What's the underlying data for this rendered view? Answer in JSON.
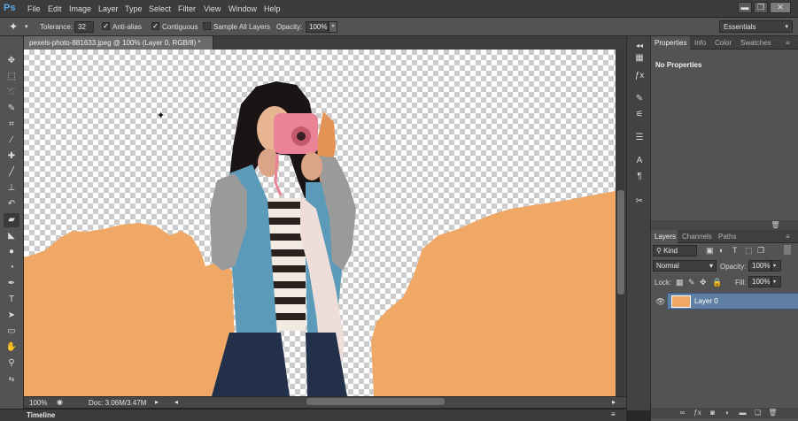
{
  "app": {
    "logo": "Ps"
  },
  "menu": [
    "File",
    "Edit",
    "Image",
    "Layer",
    "Type",
    "Select",
    "Filter",
    "View",
    "Window",
    "Help"
  ],
  "window_controls": {
    "minimize": "▬",
    "restore": "❐",
    "close": "✕"
  },
  "options": {
    "tolerance_label": "Tolerance:",
    "tolerance_value": "32",
    "anti_alias_label": "Anti-alias",
    "anti_alias_checked": true,
    "contiguous_label": "Contiguous",
    "contiguous_checked": true,
    "sample_all_label": "Sample All Layers",
    "sample_all_checked": false,
    "opacity_label": "Opacity:",
    "opacity_value": "100%",
    "workspace": "Essentials"
  },
  "document": {
    "tab_title": "pexels-photo-881633.jpeg @ 100% (Layer 0, RGB/8) *",
    "tab_close": "×",
    "colors": {
      "orange": "#f0a866",
      "orange_dark": "#e39355",
      "denim": "#5b9ab9",
      "jeans": "#22304a"
    }
  },
  "status": {
    "zoom": "100%",
    "doc_size": "Doc: 3.06M/3.47M"
  },
  "timeline": {
    "label": "Timeline"
  },
  "properties_panel": {
    "tabs": [
      "Properties",
      "Info",
      "Color",
      "Swatches"
    ],
    "active_tab": "Properties",
    "content": "No Properties"
  },
  "layers_panel": {
    "tabs": [
      "Layers",
      "Channels",
      "Paths"
    ],
    "active_tab": "Layers",
    "filter_kind": "Kind",
    "blend_mode": "Normal",
    "opacity_label": "Opacity:",
    "opacity_value": "100%",
    "lock_label": "Lock:",
    "fill_label": "Fill:",
    "fill_value": "100%",
    "layers": [
      {
        "name": "Layer 0",
        "visible": true
      }
    ]
  },
  "toolbar_icons": [
    "move-tool",
    "marquee-tool",
    "lasso-tool",
    "quick-selection-tool",
    "crop-tool",
    "eyedropper-tool",
    "spot-healing-tool",
    "brush-tool",
    "clone-stamp-tool",
    "history-brush-tool",
    "eraser-tool",
    "paint-bucket-tool",
    "blur-tool",
    "dodge-tool",
    "pen-tool",
    "type-tool",
    "path-selection-tool",
    "shape-tool",
    "hand-tool",
    "zoom-tool"
  ]
}
